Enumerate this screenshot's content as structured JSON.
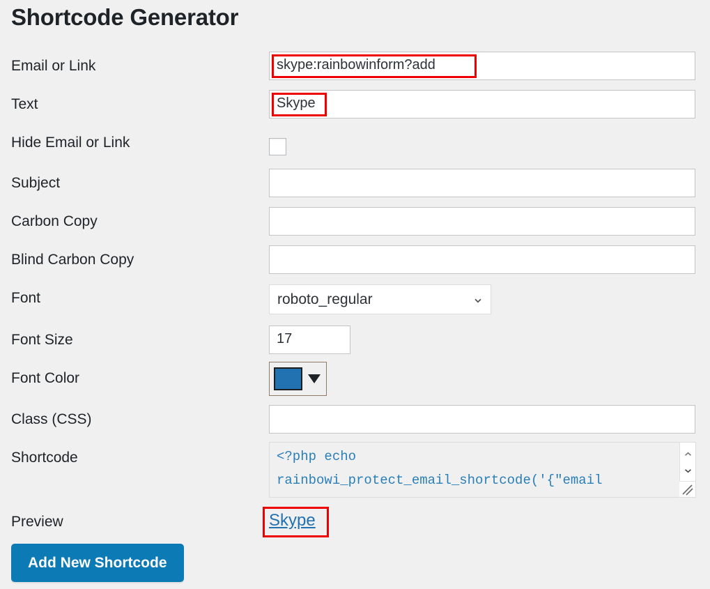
{
  "page": {
    "title": "Shortcode Generator",
    "background_color": "#f0f0f1",
    "accent_color": "#2271b1",
    "highlight_color": "#ee0000"
  },
  "form": {
    "rows": [
      {
        "label": "Email or Link",
        "type": "text",
        "value": "skype:rainbowinform?add",
        "placeholder": ""
      },
      {
        "label": "Text",
        "type": "text",
        "value": "Skype",
        "placeholder": ""
      },
      {
        "label": "Hide Email or Link",
        "type": "checkbox",
        "checked": false
      },
      {
        "label": "Subject",
        "type": "text",
        "value": "",
        "placeholder": ""
      },
      {
        "label": "Carbon Copy",
        "type": "text",
        "value": "",
        "placeholder": ""
      },
      {
        "label": "Blind Carbon Copy",
        "type": "text",
        "value": "",
        "placeholder": ""
      },
      {
        "label": "Font",
        "type": "select",
        "value": "roboto_regular"
      },
      {
        "label": "Font Size",
        "type": "number",
        "value": "17",
        "placeholder": ""
      },
      {
        "label": "Font Color",
        "type": "color",
        "value": "#2271b1"
      },
      {
        "label": "Class (CSS)",
        "type": "text",
        "value": "",
        "placeholder": ""
      },
      {
        "label": "Shortcode",
        "type": "textarea",
        "value": "<?php echo\nrainbowi_protect_email_shortcode('{\"email"
      },
      {
        "label": "Preview",
        "type": "link",
        "value": "Skype"
      }
    ]
  },
  "labels": {
    "email_or_link": "Email or Link",
    "text": "Text",
    "hide_email_or_link": "Hide Email or Link",
    "subject": "Subject",
    "carbon_copy": "Carbon Copy",
    "blind_carbon_copy": "Blind Carbon Copy",
    "font": "Font",
    "font_size": "Font Size",
    "font_color": "Font Color",
    "class_css": "Class (CSS)",
    "shortcode": "Shortcode",
    "preview": "Preview"
  },
  "values": {
    "email_or_link": "skype:rainbowinform?add",
    "text": "Skype",
    "subject": "",
    "carbon_copy": "",
    "blind_carbon_copy": "",
    "font": "roboto_regular",
    "font_size": "17",
    "font_color": "#2271b1",
    "class_css": "",
    "shortcode_line1": "<?php echo",
    "shortcode_line2": "rainbowi_protect_email_shortcode('{\"email",
    "preview_link_text": "Skype"
  },
  "select_options": {
    "font": [
      "roboto_regular"
    ]
  },
  "buttons": {
    "submit_label": "Add New Shortcode"
  },
  "icons": {
    "chevron_down": "chevron-down-icon",
    "color_caret": "caret-down-icon",
    "scroll_up": "scroll-up-arrow-icon",
    "scroll_down": "scroll-down-arrow-icon",
    "resize_grip": "resize-grip-icon"
  }
}
